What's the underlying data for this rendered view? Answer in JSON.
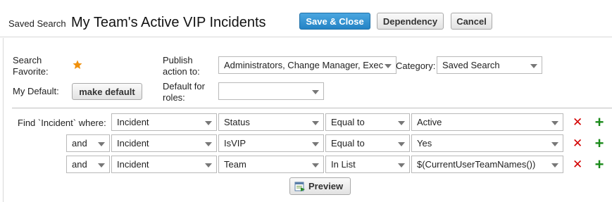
{
  "header": {
    "label": "Saved Search",
    "title": "My Team's Active VIP Incidents",
    "buttons": {
      "save_close": "Save & Close",
      "dependency": "Dependency",
      "cancel": "Cancel"
    }
  },
  "form": {
    "search_favorite_label": "Search Favorite:",
    "favorite_icon": "star-icon",
    "favorite_color": "#f0900c",
    "publish_label": "Publish action to:",
    "publish_value": "Administrators, Change Manager, Exec",
    "category_label": "Category:",
    "category_value": "Saved Search",
    "my_default_label": "My Default:",
    "make_default_button": "make default",
    "default_for_roles_label": "Default for roles:",
    "default_for_roles_value": ""
  },
  "criteria": {
    "find_label": "Find `Incident` where:",
    "rows": [
      {
        "connector": "",
        "object": "Incident",
        "field": "Status",
        "operator": "Equal to",
        "value": "Active"
      },
      {
        "connector": "and",
        "object": "Incident",
        "field": "IsVIP",
        "operator": "Equal to",
        "value": "Yes"
      },
      {
        "connector": "and",
        "object": "Incident",
        "field": "Team",
        "operator": "In List",
        "value": "$(CurrentUserTeamNames())"
      }
    ],
    "remove_icon": "x-icon",
    "add_icon": "plus-icon",
    "remove_color": "#d40000",
    "add_color": "#1a8a1a",
    "preview_button": "Preview",
    "preview_icon": "preview-icon"
  },
  "colors": {
    "accent": "#2483c5"
  }
}
